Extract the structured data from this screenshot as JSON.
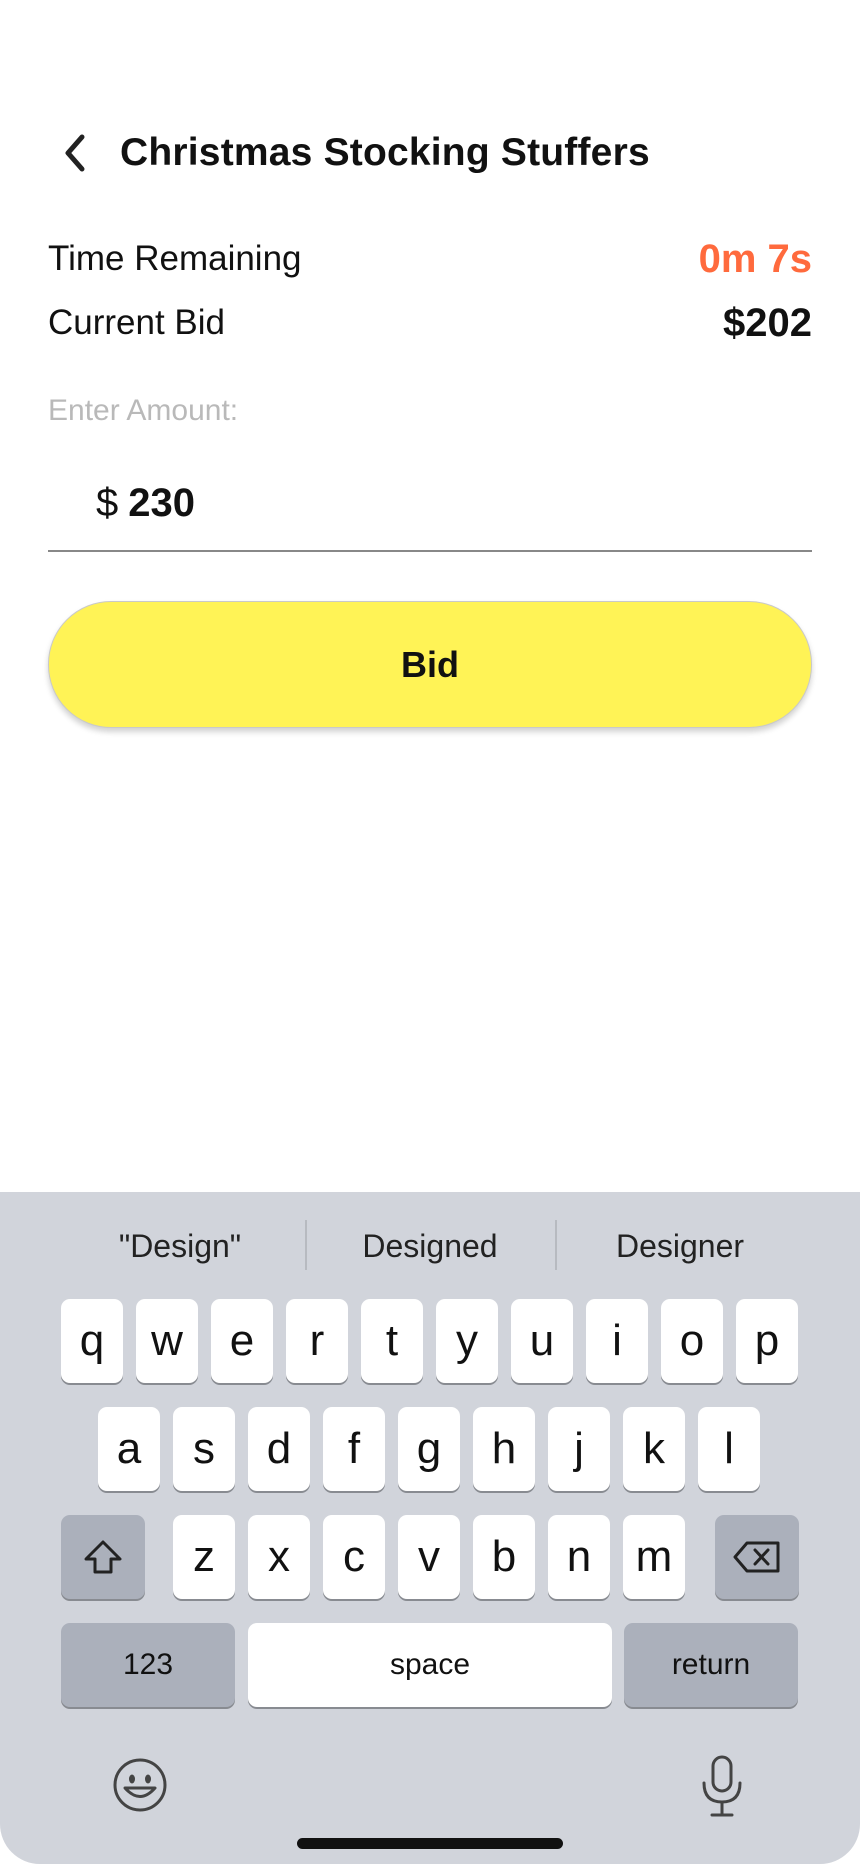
{
  "header": {
    "title": "Christmas Stocking Stuffers",
    "back_icon": "chevron-left-icon"
  },
  "auction": {
    "time_label": "Time Remaining",
    "time_value": "0m 7s",
    "bid_label": "Current Bid",
    "bid_value": "$202"
  },
  "amount": {
    "label": "Enter Amount:",
    "currency": "$",
    "value": "230"
  },
  "bid_button": {
    "label": "Bid",
    "color": "#fff356"
  },
  "colors": {
    "time_accent": "#ff6a3d",
    "keyboard_bg": "#d1d4db"
  },
  "keyboard": {
    "suggestions": [
      "\"Design\"",
      "Designed",
      "Designer"
    ],
    "row1": [
      "q",
      "w",
      "e",
      "r",
      "t",
      "y",
      "u",
      "i",
      "o",
      "p"
    ],
    "row2": [
      "a",
      "s",
      "d",
      "f",
      "g",
      "h",
      "j",
      "k",
      "l"
    ],
    "row3": [
      "z",
      "x",
      "c",
      "v",
      "b",
      "n",
      "m"
    ],
    "numbers_label": "123",
    "space_label": "space",
    "return_label": "return",
    "icons": [
      "shift-icon",
      "backspace-icon",
      "emoji-icon",
      "microphone-icon"
    ]
  }
}
